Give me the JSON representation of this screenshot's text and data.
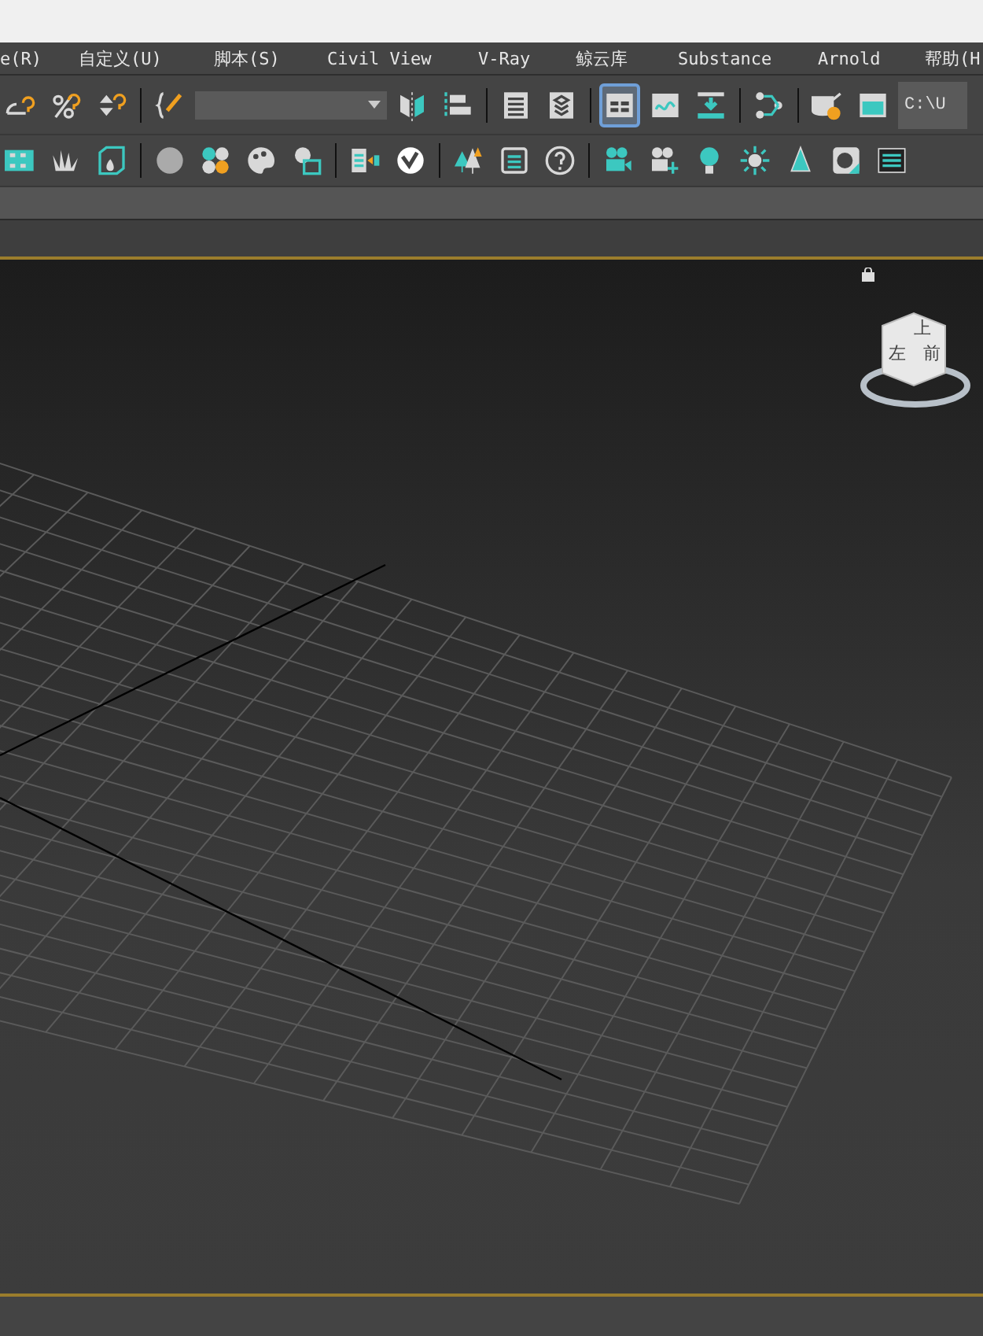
{
  "menu_bar": {
    "items": [
      {
        "label": "e(R)"
      },
      {
        "label": "自定义(U)"
      },
      {
        "label": "脚本(S)"
      },
      {
        "label": "Civil View"
      },
      {
        "label": "V-Ray"
      },
      {
        "label": "鲸云库"
      },
      {
        "label": "Substance"
      },
      {
        "label": "Arnold"
      },
      {
        "label": "帮助(H"
      }
    ]
  },
  "main_toolbar": {
    "buttons": [
      {
        "selected": false
      },
      {
        "selected": false
      },
      {
        "selected": false
      },
      {
        "selected": false
      },
      {
        "selected": false
      },
      {
        "selected": false
      },
      {
        "selected": false
      },
      {
        "selected": false
      },
      {
        "selected": true
      },
      {
        "selected": false
      },
      {
        "selected": false
      },
      {
        "selected": false
      },
      {
        "selected": false
      },
      {
        "selected": false
      }
    ],
    "path_field": {
      "value": "C:\\U"
    }
  },
  "viewport": {
    "viewcube": {
      "top": "上",
      "left": "左",
      "front": "前"
    }
  }
}
